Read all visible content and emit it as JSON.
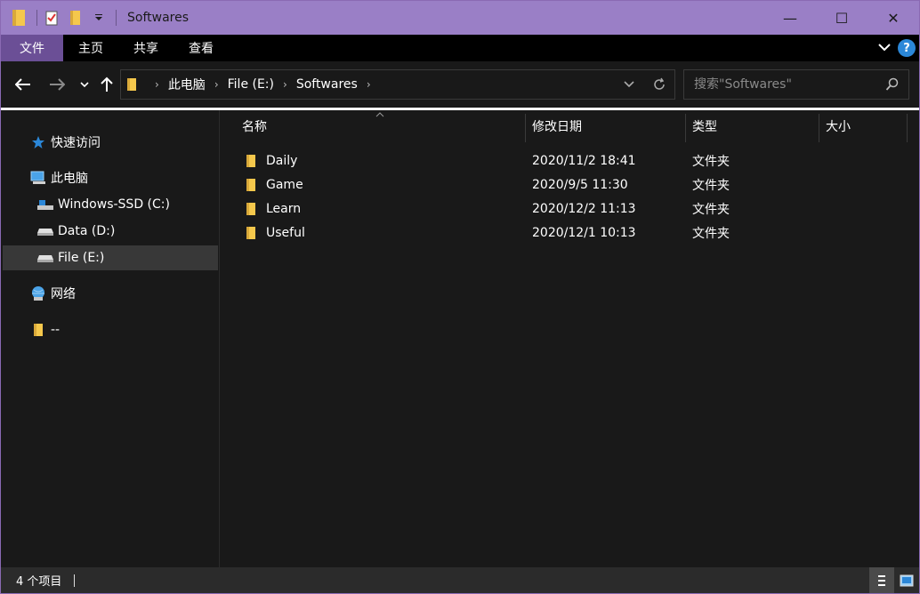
{
  "window": {
    "title": "Softwares",
    "accent_color": "#9a7fc6",
    "controls": {
      "minimize": "—",
      "maximize": "☐",
      "close": "✕"
    }
  },
  "ribbon": {
    "tabs": [
      {
        "label": "文件"
      },
      {
        "label": "主页"
      },
      {
        "label": "共享"
      },
      {
        "label": "查看"
      }
    ],
    "help_label": "?"
  },
  "address": {
    "crumbs": [
      {
        "label": "此电脑"
      },
      {
        "label": "File (E:)"
      },
      {
        "label": "Softwares"
      }
    ]
  },
  "search": {
    "placeholder": "搜索\"Softwares\""
  },
  "nav_pane": {
    "items": [
      {
        "label": "快速访问",
        "icon": "star-icon"
      },
      {
        "label": "此电脑",
        "icon": "computer-icon"
      },
      {
        "label": "Windows-SSD (C:)",
        "icon": "system-drive-icon"
      },
      {
        "label": "Data (D:)",
        "icon": "drive-icon"
      },
      {
        "label": "File (E:)",
        "icon": "drive-icon"
      },
      {
        "label": "网络",
        "icon": "network-icon"
      },
      {
        "label": "--",
        "icon": "folder-icon"
      }
    ],
    "selected": "File (E:)"
  },
  "columns": {
    "name": "名称",
    "modified": "修改日期",
    "type": "类型",
    "size": "大小"
  },
  "files": [
    {
      "name": "Daily",
      "modified": "2020/11/2 18:41",
      "type": "文件夹",
      "size": ""
    },
    {
      "name": "Game",
      "modified": "2020/9/5 11:30",
      "type": "文件夹",
      "size": ""
    },
    {
      "name": "Learn",
      "modified": "2020/12/2 11:13",
      "type": "文件夹",
      "size": ""
    },
    {
      "name": "Useful",
      "modified": "2020/12/1 10:13",
      "type": "文件夹",
      "size": ""
    }
  ],
  "status": {
    "item_count": "4 个项目"
  },
  "colors": {
    "folder": "#f5c84c",
    "background": "#191919",
    "selected": "#383838",
    "star": "#2b87d8"
  }
}
